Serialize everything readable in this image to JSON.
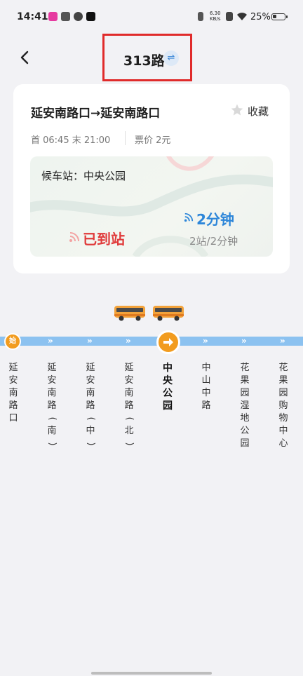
{
  "status_bar": {
    "time": "14:41",
    "net_speed_value": "6.30",
    "net_speed_unit": "KB/s",
    "battery": "25%"
  },
  "header": {
    "route_name": "313路",
    "swap_icon": "⇌"
  },
  "card": {
    "direction": "延安南路口→延安南路口",
    "favorite_label": "收藏",
    "first_last": "首 06:45   末 21:00",
    "fare": "票价 2元",
    "waiting_stop": "候车站：中央公园",
    "bus1_status": "已到站",
    "bus2_eta": "2分钟",
    "bus2_detail": "2站/2分钟"
  },
  "route_line": {
    "start_badge": "始",
    "chevron": "»",
    "current_stop_index": 4,
    "stops": [
      "延安南路口",
      "延安南路(南)",
      "延安南路(中)",
      "延安南路(北)",
      "中央公园",
      "中山中路",
      "花果园湿地公园",
      "花果园购物中心"
    ]
  },
  "colors": {
    "accent_orange": "#f29c1f",
    "eta_blue": "#2d86d9",
    "arrived_red": "#e03a3a",
    "route_line_blue": "#8cc2f0",
    "highlight_box_red": "#e02b2b"
  }
}
